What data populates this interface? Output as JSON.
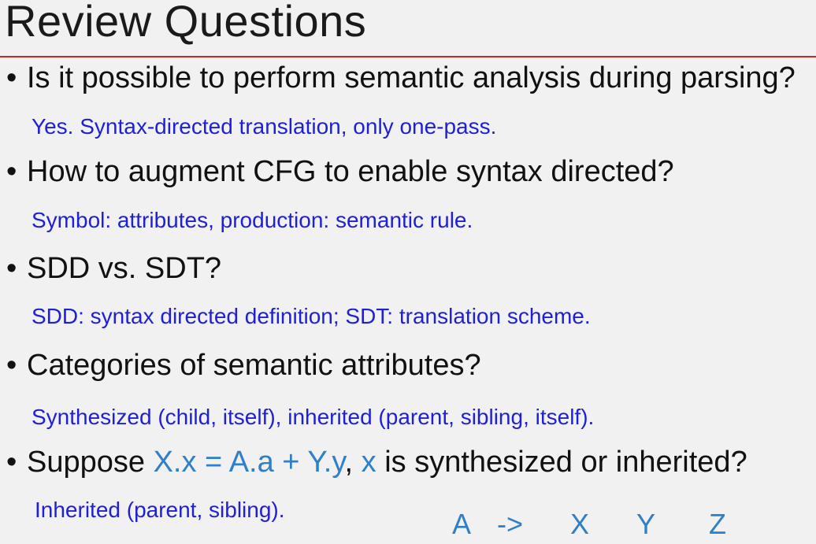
{
  "slide": {
    "title": "Review Questions"
  },
  "bullet_glyph": "•",
  "items": [
    {
      "question": "Is it possible to perform semantic analysis during parsing?",
      "answer": "Yes. Syntax-directed translation, only one-pass."
    },
    {
      "question": "How to augment CFG to enable syntax directed?",
      "answer": "Symbol: attributes, production: semantic rule."
    },
    {
      "question": "SDD vs. SDT?",
      "answer": "SDD: syntax directed definition; SDT: translation scheme."
    },
    {
      "question": "Categories of semantic attributes?",
      "answer": "Synthesized (child, itself), inherited (parent, sibling, itself)."
    },
    {
      "question_parts": [
        "Suppose ",
        "X.x = A.a + Y.y",
        ", ",
        "x",
        " is synthesized or inherited?"
      ],
      "answer": "Inherited (parent, sibling)."
    }
  ],
  "production": {
    "lhs": "A",
    "arrow": "->",
    "rhs": [
      "X",
      "Y",
      "Z"
    ]
  },
  "colors": {
    "title_rule": "#c0262b",
    "answer_text": "#1f1fd6",
    "highlight_text": "#2f7fc9",
    "background": "#f1f1f1"
  }
}
